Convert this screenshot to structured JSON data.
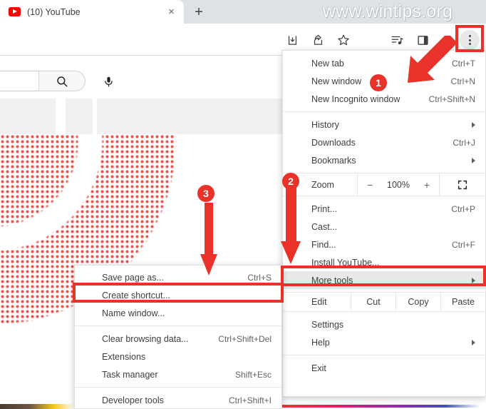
{
  "watermark": "www.wintips.org",
  "browser": {
    "tab": {
      "title": "(10) YouTube",
      "favicon": "youtube-icon",
      "close": "×"
    },
    "new_tab_button": "+",
    "toolbar_icons": [
      "download-icon",
      "share-icon",
      "bookmark-star-icon",
      "media-control-icon",
      "side-panel-icon",
      "three-dot-menu-icon"
    ]
  },
  "page": {
    "search_placeholder": "",
    "search_icon": "search-icon",
    "mic_icon": "microphone-icon"
  },
  "menu": {
    "items": [
      {
        "label": "New tab",
        "accel": "Ctrl+T",
        "caret": false
      },
      {
        "label": "New window",
        "accel": "Ctrl+N",
        "caret": false
      },
      {
        "label": "New Incognito window",
        "accel": "Ctrl+Shift+N",
        "caret": false
      },
      {
        "label": "History",
        "accel": "",
        "caret": true
      },
      {
        "label": "Downloads",
        "accel": "Ctrl+J",
        "caret": false
      },
      {
        "label": "Bookmarks",
        "accel": "",
        "caret": true
      },
      {
        "label": "Print...",
        "accel": "Ctrl+P",
        "caret": false
      },
      {
        "label": "Cast...",
        "accel": "",
        "caret": false
      },
      {
        "label": "Find...",
        "accel": "Ctrl+F",
        "caret": false
      },
      {
        "label": "Install YouTube...",
        "accel": "",
        "caret": false
      },
      {
        "label": "More tools",
        "accel": "",
        "caret": true
      },
      {
        "label": "Settings",
        "accel": "",
        "caret": false
      },
      {
        "label": "Help",
        "accel": "",
        "caret": true
      },
      {
        "label": "Exit",
        "accel": "",
        "caret": false
      }
    ],
    "zoom": {
      "label": "Zoom",
      "minus": "−",
      "percent": "100%",
      "plus": "+",
      "fullscreen_icon": "fullscreen-icon"
    },
    "edit_row": {
      "label": "Edit",
      "cut": "Cut",
      "copy": "Copy",
      "paste": "Paste"
    }
  },
  "submenu": {
    "items": [
      {
        "label": "Save page as...",
        "accel": "Ctrl+S"
      },
      {
        "label": "Create shortcut...",
        "accel": ""
      },
      {
        "label": "Name window...",
        "accel": ""
      },
      {
        "label": "Clear browsing data...",
        "accel": "Ctrl+Shift+Del"
      },
      {
        "label": "Extensions",
        "accel": ""
      },
      {
        "label": "Task manager",
        "accel": "Shift+Esc"
      },
      {
        "label": "Developer tools",
        "accel": "Ctrl+Shift+I"
      }
    ]
  },
  "callouts": {
    "one": "1",
    "two": "2",
    "three": "3",
    "highlight_color": "#e8322a"
  }
}
